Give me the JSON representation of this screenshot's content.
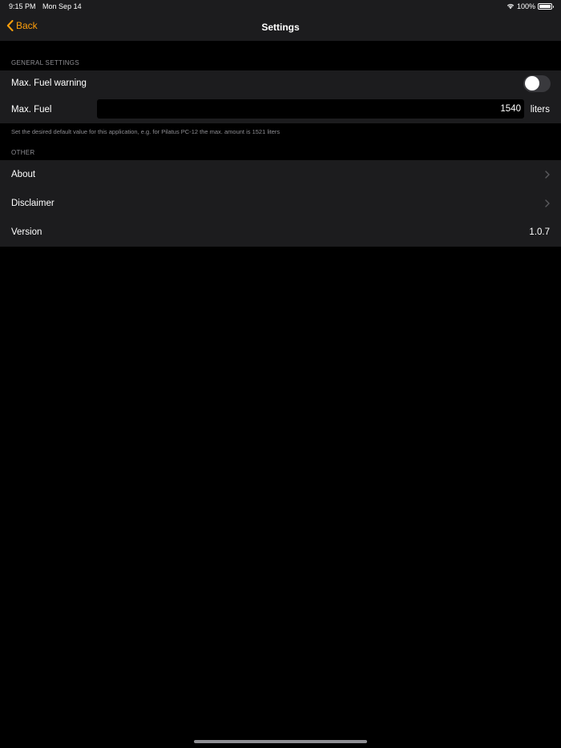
{
  "status_bar": {
    "time": "9:15 PM",
    "date": "Mon Sep 14",
    "battery": "100%",
    "icons": [
      "wifi-icon",
      "battery-icon"
    ]
  },
  "nav": {
    "back_label": "Back",
    "title": "Settings",
    "accent_color": "#ff9f0a"
  },
  "general": {
    "header": "GENERAL SETTINGS",
    "max_fuel_warning_label": "Max. Fuel warning",
    "max_fuel_warning_on": false,
    "max_fuel_label": "Max. Fuel",
    "max_fuel_value": "1540",
    "max_fuel_unit": "liters",
    "footer": "Set the desired default value for this application, e.g. for Pilatus PC-12 the max. amount is 1521 liters"
  },
  "other": {
    "header": "OTHER",
    "about_label": "About",
    "disclaimer_label": "Disclaimer",
    "version_label": "Version",
    "version_value": "1.0.7"
  }
}
